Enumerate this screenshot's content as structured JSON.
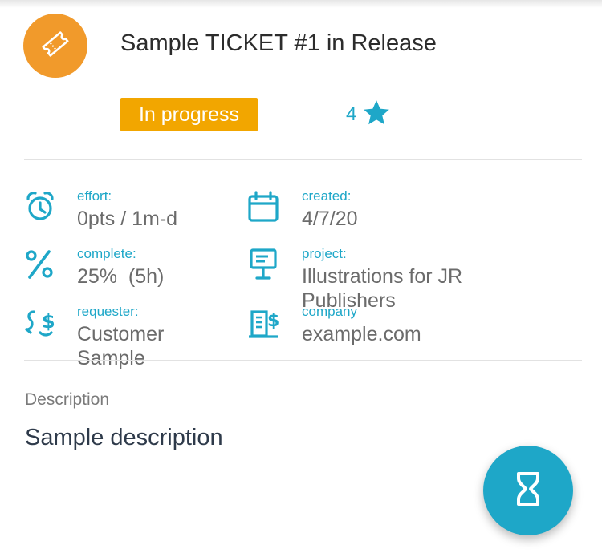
{
  "ticket": {
    "title": "Sample TICKET #1 in Release",
    "icon": "ticket-icon",
    "status": "In progress",
    "priority": "4",
    "priority_icon": "star-icon"
  },
  "details": {
    "effort": {
      "label": "effort:",
      "value": "0pts / 1m-d",
      "icon": "alarm-clock-icon"
    },
    "created": {
      "label": "created:",
      "value": "4/7/20",
      "icon": "calendar-icon"
    },
    "complete": {
      "label": "complete:",
      "value": "25%  (5h)",
      "icon": "percent-icon"
    },
    "project": {
      "label": "project:",
      "value": "Illustrations for JR Publishers",
      "icon": "presentation-board-icon"
    },
    "requester": {
      "label": "requester:",
      "value": "Customer Sample",
      "icon": "requester-dollar-icon"
    },
    "company": {
      "label": "company",
      "value": "example.com",
      "icon": "company-building-dollar-icon"
    }
  },
  "description": {
    "label": "Description",
    "value": "Sample description"
  },
  "fab": {
    "icon": "hourglass-icon"
  },
  "colors": {
    "accent": "#1ea7c8",
    "status_badge": "#f2a600",
    "avatar": "#f19a2b"
  }
}
